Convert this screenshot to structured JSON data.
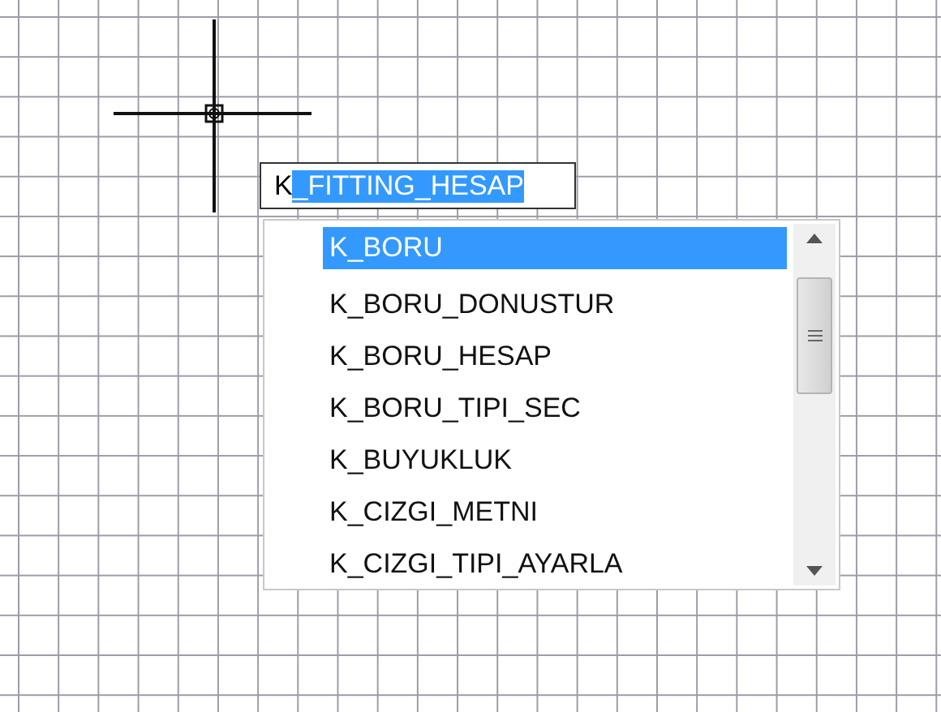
{
  "command_input": {
    "typed": "K",
    "completion": "_FITTING_HESAP"
  },
  "suggestions": [
    {
      "label": "K_BORU",
      "selected": true
    },
    {
      "label": "K_BORU_DONUSTUR",
      "selected": false
    },
    {
      "label": "K_BORU_HESAP",
      "selected": false
    },
    {
      "label": "K_BORU_TIPI_SEC",
      "selected": false
    },
    {
      "label": "K_BUYUKLUK",
      "selected": false
    },
    {
      "label": "K_CIZGI_METNI",
      "selected": false
    },
    {
      "label": "K_CIZGI_TIPI_AYARLA",
      "selected": false
    }
  ]
}
